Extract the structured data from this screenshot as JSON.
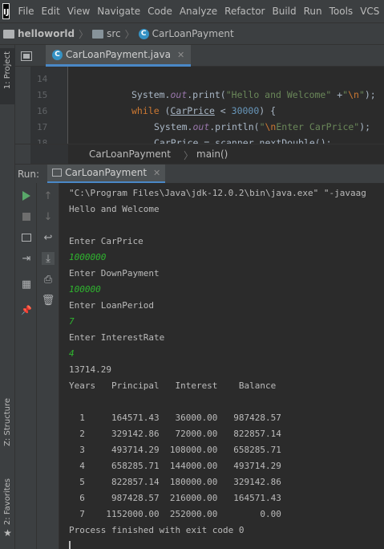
{
  "menu": [
    "File",
    "Edit",
    "View",
    "Navigate",
    "Code",
    "Analyze",
    "Refactor",
    "Build",
    "Run",
    "Tools",
    "VCS"
  ],
  "app_logo": "IJ",
  "breadcrumb": {
    "project": "helloworld",
    "folder": "src",
    "class": "CarLoanPayment"
  },
  "editor": {
    "tab_title": "CarLoanPayment.java",
    "line_numbers": [
      "14",
      "15",
      "16",
      "17",
      "18"
    ],
    "breadcrumb_class": "CarLoanPayment",
    "breadcrumb_method": "main()"
  },
  "left_stripe": {
    "top_tab": "1: Project",
    "structure_tab": "Z: Structure",
    "favorites_tab": "2: Favorites"
  },
  "run": {
    "label": "Run:",
    "tab_title": "CarLoanPayment"
  },
  "console": {
    "command": "\"C:\\Program Files\\Java\\jdk-12.0.2\\bin\\java.exe\" \"-javaag",
    "welcome": "Hello and Welcome",
    "prompt_price": "Enter CarPrice",
    "input_price": "1000000",
    "prompt_down": "Enter DownPayment",
    "input_down": "100000",
    "prompt_period": "Enter LoanPeriod",
    "input_period": "7",
    "prompt_rate": "Enter InterestRate",
    "input_rate": "4",
    "monthly": "13714.29",
    "header": "Years   Principal   Interest    Balance",
    "rows": [
      "  1     164571.43   36000.00   987428.57",
      "  2     329142.86   72000.00   822857.14",
      "  3     493714.29  108000.00   658285.71",
      "  4     658285.71  144000.00   493714.29",
      "  5     822857.14  180000.00   329142.86",
      "  6     987428.57  216000.00   164571.43",
      "  7    1152000.00  252000.00        0.00"
    ],
    "exit_message": "Process finished with exit code 0"
  }
}
